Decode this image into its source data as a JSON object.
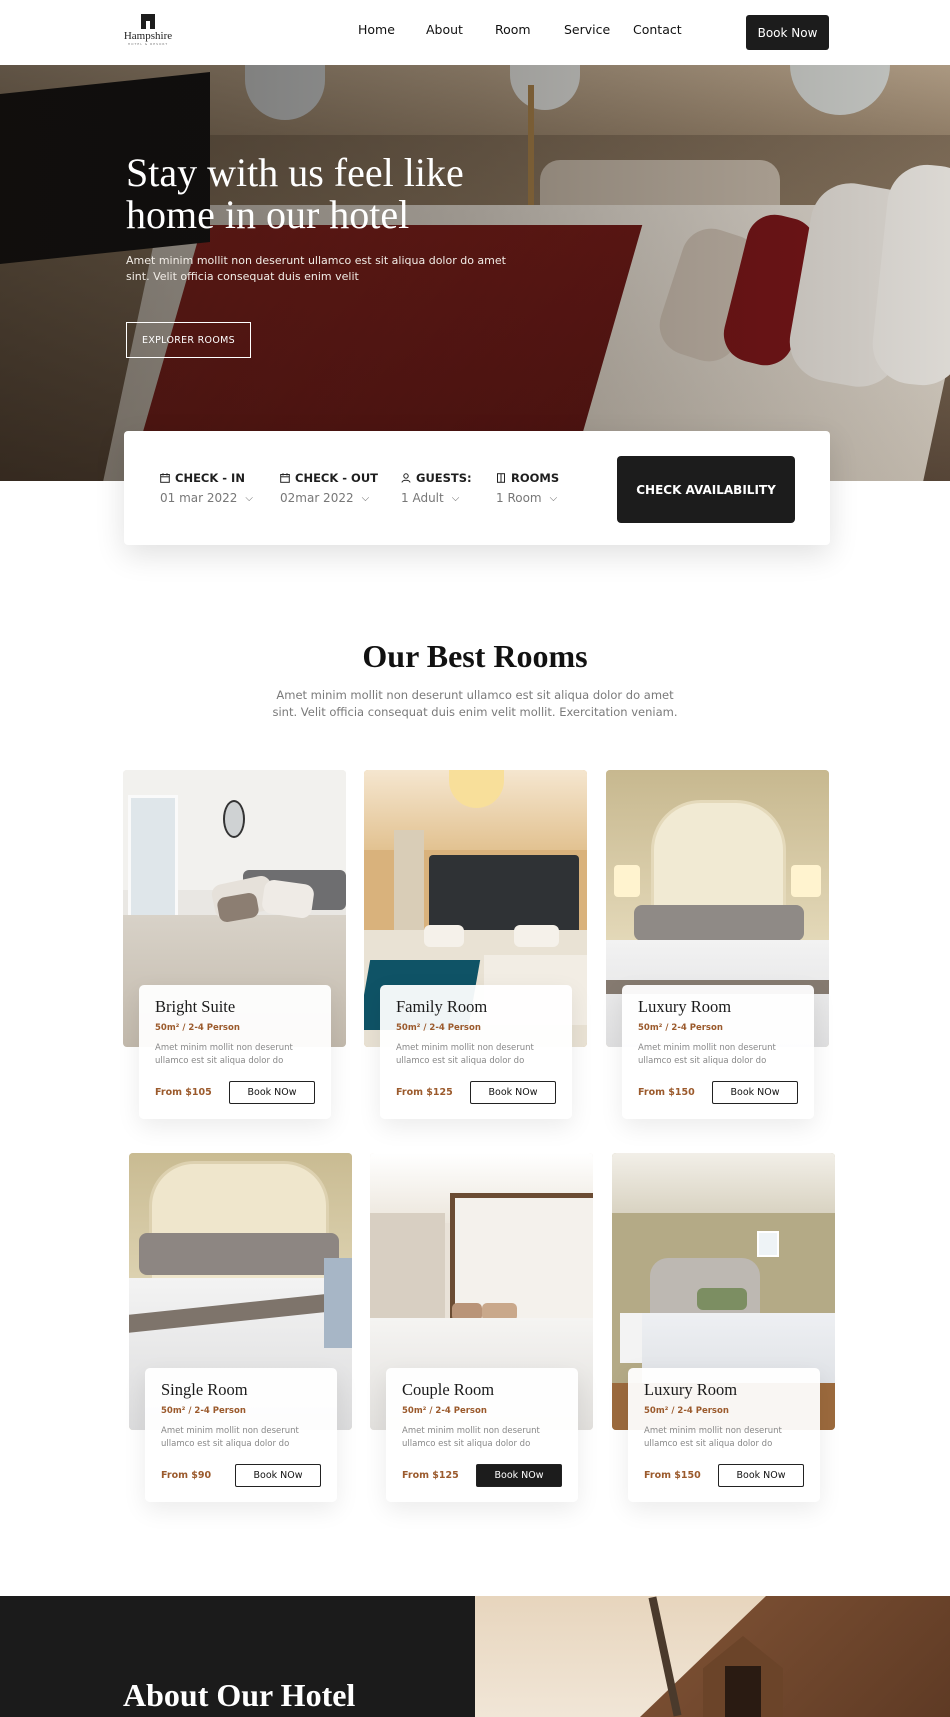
{
  "brand": {
    "name": "Hampshire",
    "tagline": "HOTEL & RESORT"
  },
  "nav": {
    "links": [
      "Home",
      "About",
      "Room",
      "Service",
      "Contact"
    ],
    "cta": "Book Now"
  },
  "hero": {
    "title": "Stay with us feel like home in our hotel",
    "subtitle": "Amet minim mollit non deserunt ullamco est sit aliqua dolor do amet sint. Velit officia consequat duis enim velit",
    "button": "EXPLORER ROOMS"
  },
  "booking": {
    "fields": [
      {
        "label": "CHECK - IN",
        "value": "01 mar 2022",
        "icon": "calendar-icon"
      },
      {
        "label": "CHECK - OUT",
        "value": "02mar 2022",
        "icon": "calendar-icon"
      },
      {
        "label": "GUESTS:",
        "value": "1 Adult",
        "icon": "user-icon"
      },
      {
        "label": "ROOMS",
        "value": "1 Room",
        "icon": "door-icon"
      }
    ],
    "button": "CHECK AVAILABILITY"
  },
  "rooms_section": {
    "title": "Our Best Rooms",
    "subtitle": "Amet minim mollit non deserunt ullamco est sit aliqua dolor do amet sint. Velit officia consequat duis enim velit mollit. Exercitation veniam."
  },
  "rooms": [
    {
      "name": "Bright Suite",
      "size": "50m² / 2-4 Person",
      "desc": "Amet minim mollit non deserunt ullamco est sit aliqua dolor do",
      "price": "From $105",
      "button": "Book NOw"
    },
    {
      "name": "Family Room",
      "size": "50m² / 2-4 Person",
      "desc": "Amet minim mollit non deserunt ullamco est sit aliqua dolor do",
      "price": "From $125",
      "button": "Book NOw"
    },
    {
      "name": "Luxury Room",
      "size": "50m² / 2-4 Person",
      "desc": "Amet minim mollit non deserunt ullamco est sit aliqua dolor do",
      "price": "From $150",
      "button": "Book NOw"
    },
    {
      "name": "Single Room",
      "size": "50m² / 2-4 Person",
      "desc": "Amet minim mollit non deserunt ullamco est sit aliqua dolor do",
      "price": "From $90",
      "button": "Book NOw"
    },
    {
      "name": "Couple Room",
      "size": "50m² / 2-4 Person",
      "desc": "Amet minim mollit non deserunt ullamco est sit aliqua dolor do",
      "price": "From $125",
      "button": "Book NOw"
    },
    {
      "name": "Luxury Room",
      "size": "50m² / 2-4 Person",
      "desc": "Amet minim mollit non deserunt ullamco est sit aliqua dolor do",
      "price": "From $150",
      "button": "Book NOw"
    }
  ],
  "about": {
    "title": "About Our Hotel"
  },
  "colors": {
    "accent": "#9b5a2c",
    "dark": "#1c1c1c"
  }
}
